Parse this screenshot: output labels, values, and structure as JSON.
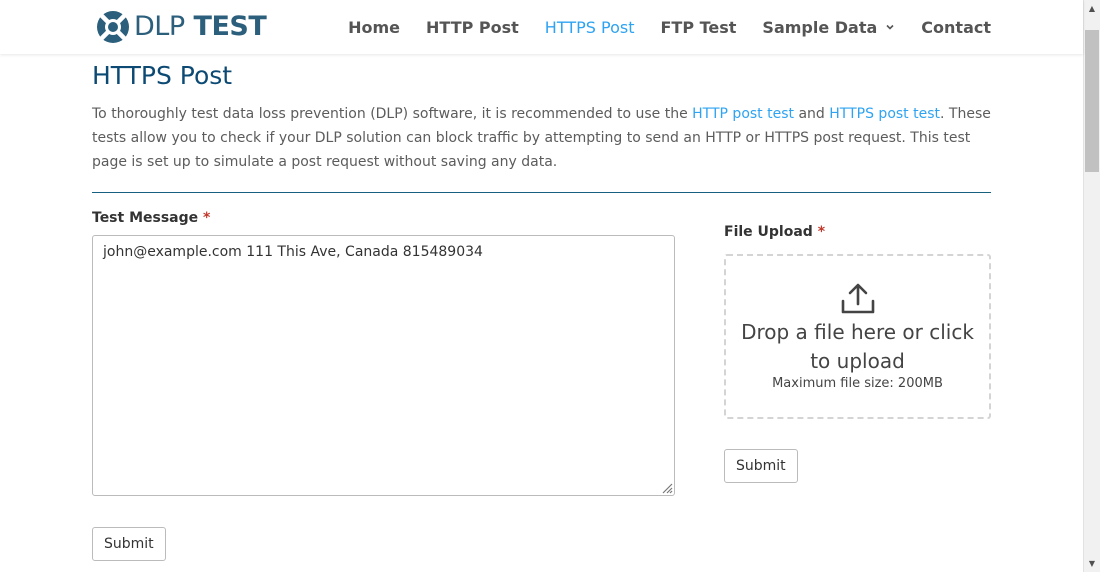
{
  "header": {
    "logo": {
      "part1": "DLP",
      "part2": "TEST"
    },
    "nav": [
      {
        "label": "Home"
      },
      {
        "label": "HTTP Post"
      },
      {
        "label": "HTTPS Post"
      },
      {
        "label": "FTP Test"
      },
      {
        "label": "Sample Data"
      },
      {
        "label": "Contact"
      }
    ],
    "active_nav": "HTTPS Post"
  },
  "page": {
    "title": "HTTPS Post",
    "intro": {
      "part1": "To thoroughly test data loss prevention (DLP) software, it is recommended to use the ",
      "link1": "HTTP post test",
      "part2": " and ",
      "link2": "HTTPS post test",
      "part3": ". These tests allow you to check if your DLP solution can block traffic by attempting to send an HTTP or HTTPS post request. This test page is set up to simulate a post request without saving any data."
    }
  },
  "message_form": {
    "label": "Test Message",
    "required_mark": "*",
    "value": "john@example.com 111 This Ave, Canada 815489034",
    "submit_label": "Submit"
  },
  "upload_form": {
    "label": "File Upload",
    "required_mark": "*",
    "drop_text": "Drop a file here or click to upload",
    "max_size_text": "Maximum file size: 200MB",
    "submit_label": "Submit"
  },
  "colors": {
    "accent": "#2ea3f2",
    "title": "#0c4a74",
    "logo": "#2c5f7c",
    "divider": "#17607f",
    "required": "#c0392b"
  },
  "icons": {
    "logo_mark": "dlp-logo-icon",
    "dropdown": "chevron-down-icon",
    "upload": "upload-icon",
    "grip": "resize-grip-icon"
  }
}
